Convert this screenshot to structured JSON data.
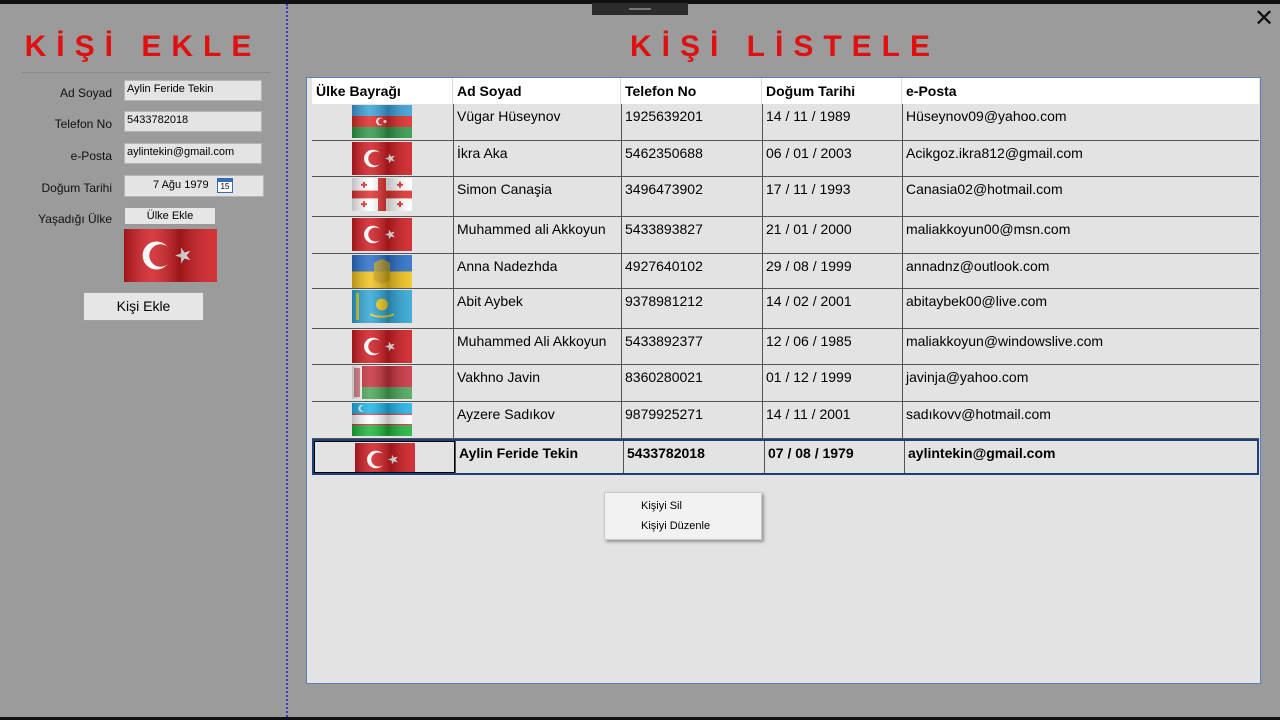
{
  "left": {
    "title": "KİŞİ EKLE",
    "fields": {
      "name_label": "Ad Soyad",
      "name_value": "Aylin Feride Tekin",
      "phone_label": "Telefon No",
      "phone_value": "5433782018",
      "email_label": "e-Posta",
      "email_value": "aylintekin@gmail.com",
      "birth_label": "Doğum Tarihi",
      "birth_value": "7 Ağu 1979",
      "calendar_day": "15",
      "country_label": "Yaşadığı Ülke",
      "country_button": "Ülke Ekle"
    },
    "add_button": "Kişi Ekle",
    "preview_flag": "turkey"
  },
  "right": {
    "title": "KİŞİ LİSTELE",
    "columns": [
      "Ülke Bayrağı",
      "Ad Soyad",
      "Telefon No",
      "Doğum Tarihi",
      "e-Posta"
    ],
    "rows": [
      {
        "flag": "azerbaijan",
        "name": "Vügar Hüseynov",
        "phone": "1925639201",
        "birth": "14 / 11 / 1989",
        "email": "Hüseynov09@yahoo.com"
      },
      {
        "flag": "turkey",
        "name": "İkra Aka",
        "phone": "5462350688",
        "birth": "06 / 01 / 2003",
        "email": "Acikgoz.ikra812@gmail.com"
      },
      {
        "flag": "georgia",
        "name": "Simon Canaşia",
        "phone": "3496473902",
        "birth": "17 / 11 / 1993",
        "email": "Canasia02@hotmail.com"
      },
      {
        "flag": "turkey",
        "name": "Muhammed ali Akkoyun",
        "phone": "5433893827",
        "birth": "21 / 01 / 2000",
        "email": "maliakkoyun00@msn.com"
      },
      {
        "flag": "ukraine",
        "name": "Anna Nadezhda",
        "phone": "4927640102",
        "birth": "29 / 08 / 1999",
        "email": "annadnz@outlook.com"
      },
      {
        "flag": "kazakhstan",
        "name": "Abit Aybek",
        "phone": "9378981212",
        "birth": "14 / 02 / 2001",
        "email": "abitaybek00@live.com"
      },
      {
        "flag": "turkey",
        "name": "Muhammed Ali Akkoyun",
        "phone": "5433892377",
        "birth": "12 / 06 / 1985",
        "email": "maliakkoyun@windowslive.com"
      },
      {
        "flag": "belarus",
        "name": "Vakhno Javin",
        "phone": "8360280021",
        "birth": "01 / 12 / 1999",
        "email": "javinja@yahoo.com"
      },
      {
        "flag": "uzbekistan",
        "name": "Ayzere Sadıkov",
        "phone": "9879925271",
        "birth": "14 / 11 / 2001",
        "email": "sadıkovv@hotmail.com"
      },
      {
        "flag": "turkey",
        "name": "Aylin Feride Tekin",
        "phone": "5433782018",
        "birth": "07 / 08 / 1979",
        "email": "aylintekin@gmail.com",
        "selected": true
      }
    ]
  },
  "context_menu": {
    "items": [
      "Kişiyi Sil",
      "Kişiyi Düzenle"
    ]
  },
  "colors": {
    "title_red": "#e01010",
    "selection_border": "#1c3f80"
  }
}
